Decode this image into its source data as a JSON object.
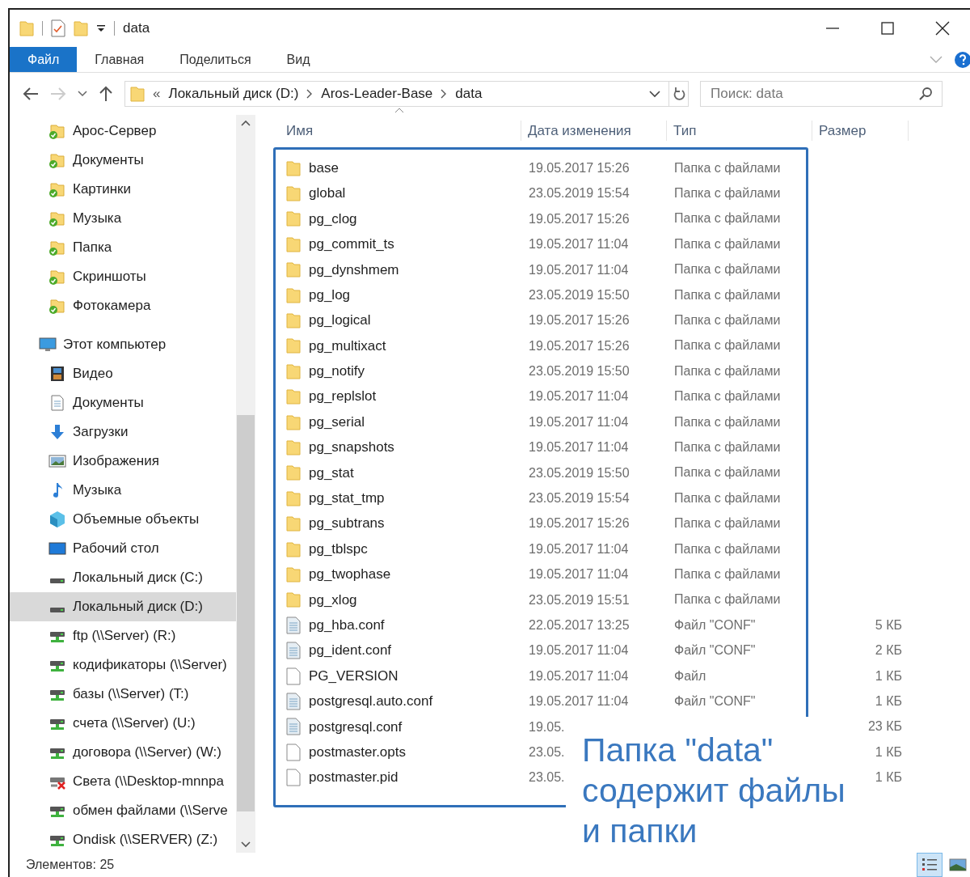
{
  "window": {
    "title": "data"
  },
  "ribbon_tabs": [
    {
      "label": "Файл",
      "selected": true
    },
    {
      "label": "Главная",
      "selected": false
    },
    {
      "label": "Поделиться",
      "selected": false
    },
    {
      "label": "Вид",
      "selected": false
    }
  ],
  "address": {
    "overflow": "«",
    "crumbs": [
      "Локальный диск (D:)",
      "Aros-Leader-Base",
      "data"
    ]
  },
  "search": {
    "placeholder": "Поиск: data"
  },
  "sidebar": {
    "items": [
      {
        "label": "Арос-Сервер",
        "kind": "pinned",
        "selected": false
      },
      {
        "label": "Документы",
        "kind": "pinned",
        "selected": false
      },
      {
        "label": "Картинки",
        "kind": "pinned",
        "selected": false
      },
      {
        "label": "Музыка",
        "kind": "pinned",
        "selected": false
      },
      {
        "label": "Папка",
        "kind": "pinned",
        "selected": false
      },
      {
        "label": "Скриншоты",
        "kind": "pinned",
        "selected": false
      },
      {
        "label": "Фотокамера",
        "kind": "pinned",
        "selected": false
      },
      {
        "label": "Этот компьютер",
        "kind": "computer",
        "selected": false
      },
      {
        "label": "Видео",
        "kind": "video",
        "selected": false
      },
      {
        "label": "Документы",
        "kind": "docs",
        "selected": false
      },
      {
        "label": "Загрузки",
        "kind": "download",
        "selected": false
      },
      {
        "label": "Изображения",
        "kind": "images",
        "selected": false
      },
      {
        "label": "Музыка",
        "kind": "music",
        "selected": false
      },
      {
        "label": "Объемные объекты",
        "kind": "cube",
        "selected": false
      },
      {
        "label": "Рабочий стол",
        "kind": "desktop",
        "selected": false
      },
      {
        "label": "Локальный диск (C:)",
        "kind": "drive",
        "selected": false
      },
      {
        "label": "Локальный диск (D:)",
        "kind": "drive",
        "selected": true
      },
      {
        "label": "ftp (\\\\Server) (R:)",
        "kind": "net",
        "selected": false
      },
      {
        "label": "кодификаторы (\\\\Server)",
        "kind": "net",
        "selected": false
      },
      {
        "label": "базы (\\\\Server) (T:)",
        "kind": "net",
        "selected": false
      },
      {
        "label": "счета (\\\\Server) (U:)",
        "kind": "net",
        "selected": false
      },
      {
        "label": "договора (\\\\Server) (W:)",
        "kind": "net",
        "selected": false
      },
      {
        "label": "Света (\\\\Desktop-mnnpa",
        "kind": "net-error",
        "selected": false
      },
      {
        "label": "обмен файлами (\\\\Serve",
        "kind": "net",
        "selected": false
      },
      {
        "label": "Ondisk (\\\\SERVER) (Z:)",
        "kind": "net",
        "selected": false
      }
    ]
  },
  "table": {
    "columns": [
      "Имя",
      "Дата изменения",
      "Тип",
      "Размер"
    ],
    "rows": [
      {
        "name": "base",
        "kind": "folder",
        "date": "19.05.2017 15:26",
        "type": "Папка с файлами"
      },
      {
        "name": "global",
        "kind": "folder",
        "date": "23.05.2019 15:54",
        "type": "Папка с файлами"
      },
      {
        "name": "pg_clog",
        "kind": "folder",
        "date": "19.05.2017 15:26",
        "type": "Папка с файлами"
      },
      {
        "name": "pg_commit_ts",
        "kind": "folder",
        "date": "19.05.2017 11:04",
        "type": "Папка с файлами"
      },
      {
        "name": "pg_dynshmem",
        "kind": "folder",
        "date": "19.05.2017 11:04",
        "type": "Папка с файлами"
      },
      {
        "name": "pg_log",
        "kind": "folder",
        "date": "23.05.2019 15:50",
        "type": "Папка с файлами"
      },
      {
        "name": "pg_logical",
        "kind": "folder",
        "date": "19.05.2017 15:26",
        "type": "Папка с файлами"
      },
      {
        "name": "pg_multixact",
        "kind": "folder",
        "date": "19.05.2017 15:26",
        "type": "Папка с файлами"
      },
      {
        "name": "pg_notify",
        "kind": "folder",
        "date": "23.05.2019 15:50",
        "type": "Папка с файлами"
      },
      {
        "name": "pg_replslot",
        "kind": "folder",
        "date": "19.05.2017 11:04",
        "type": "Папка с файлами"
      },
      {
        "name": "pg_serial",
        "kind": "folder",
        "date": "19.05.2017 11:04",
        "type": "Папка с файлами"
      },
      {
        "name": "pg_snapshots",
        "kind": "folder",
        "date": "19.05.2017 11:04",
        "type": "Папка с файлами"
      },
      {
        "name": "pg_stat",
        "kind": "folder",
        "date": "23.05.2019 15:50",
        "type": "Папка с файлами"
      },
      {
        "name": "pg_stat_tmp",
        "kind": "folder",
        "date": "23.05.2019 15:54",
        "type": "Папка с файлами"
      },
      {
        "name": "pg_subtrans",
        "kind": "folder",
        "date": "19.05.2017 15:26",
        "type": "Папка с файлами"
      },
      {
        "name": "pg_tblspc",
        "kind": "folder",
        "date": "19.05.2017 11:04",
        "type": "Папка с файлами"
      },
      {
        "name": "pg_twophase",
        "kind": "folder",
        "date": "19.05.2017 11:04",
        "type": "Папка с файлами"
      },
      {
        "name": "pg_xlog",
        "kind": "folder",
        "date": "23.05.2019 15:51",
        "type": "Папка с файлами"
      },
      {
        "name": "pg_hba.conf",
        "kind": "conf",
        "date": "22.05.2017 13:25",
        "type": "Файл \"CONF\"",
        "size": "5 КБ"
      },
      {
        "name": "pg_ident.conf",
        "kind": "conf",
        "date": "19.05.2017 11:04",
        "type": "Файл \"CONF\"",
        "size": "2 КБ"
      },
      {
        "name": "PG_VERSION",
        "kind": "file",
        "date": "19.05.2017 11:04",
        "type": "Файл",
        "size": "1 КБ"
      },
      {
        "name": "postgresql.auto.conf",
        "kind": "conf",
        "date": "19.05.2017 11:04",
        "type": "Файл \"CONF\"",
        "size": "1 КБ"
      },
      {
        "name": "postgresql.conf",
        "kind": "conf",
        "date": "19.05.",
        "size": "23 КБ"
      },
      {
        "name": "postmaster.opts",
        "kind": "file",
        "date": "23.05.",
        "size": "1 КБ"
      },
      {
        "name": "postmaster.pid",
        "kind": "file",
        "date": "23.05.",
        "size": "1 КБ"
      }
    ]
  },
  "annotation": {
    "lines": [
      "Папка \"data\"",
      "содержит файлы",
      "и папки"
    ]
  },
  "status_bar": {
    "count": "Элементов: 25"
  }
}
